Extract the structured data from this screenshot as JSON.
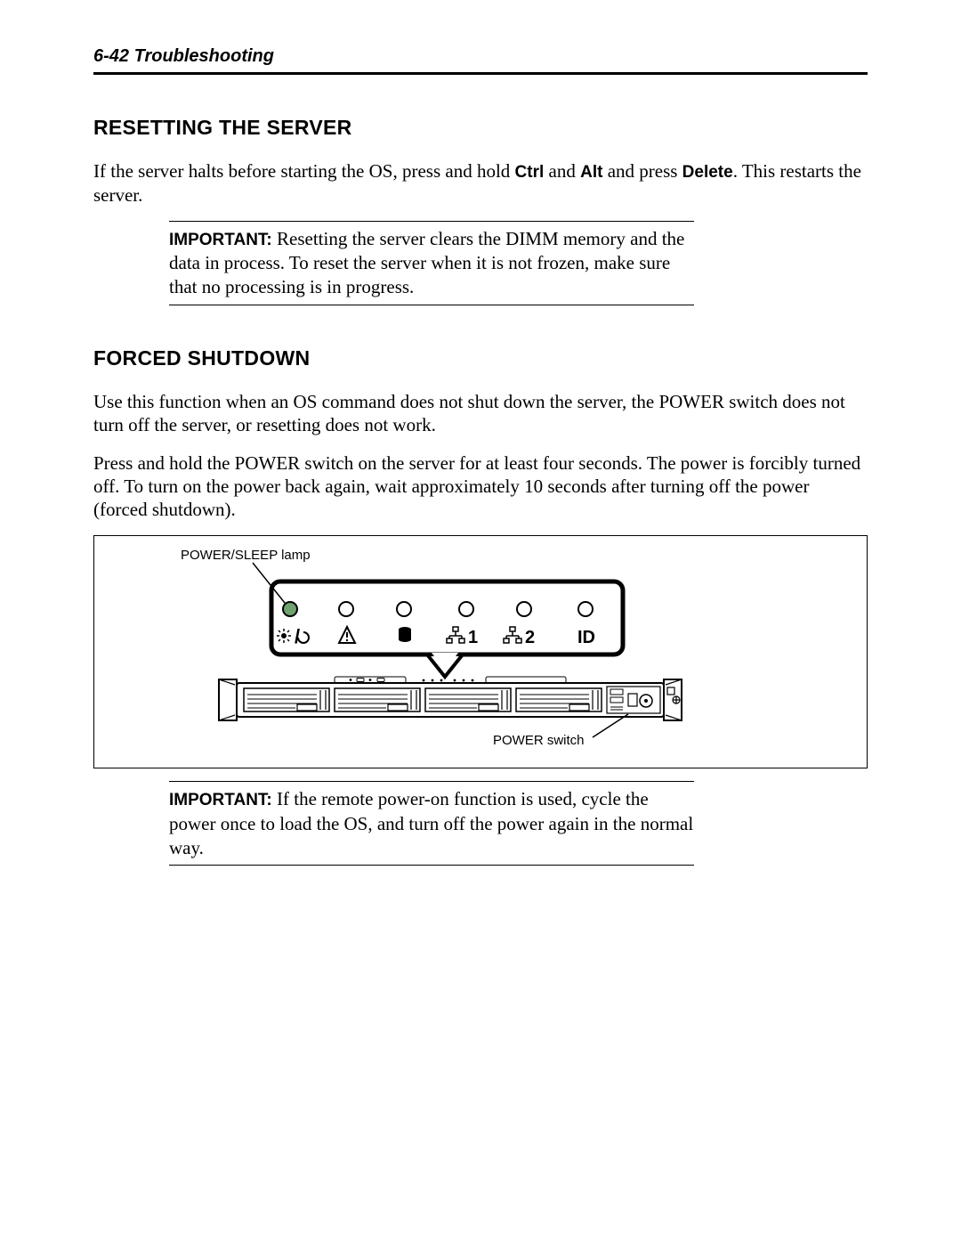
{
  "header": {
    "running": "6-42  Troubleshooting"
  },
  "section1": {
    "title": "RESETTING THE SERVER",
    "p1a": "If the server halts before starting the OS, press and hold ",
    "ctrl": "Ctrl",
    "p1b": " and ",
    "alt": "Alt",
    "p1c": " and press ",
    "del": "Delete",
    "p1d": ".  This restarts the server.",
    "note_label": "IMPORTANT:",
    "note_text": " Resetting the server clears the DIMM memory and the data in process.  To reset the server when it is not frozen, make sure that no processing is in progress."
  },
  "section2": {
    "title": "FORCED SHUTDOWN",
    "p1": "Use this function when an OS command does not shut down the server, the POWER switch does not turn off the server, or resetting does not work.",
    "p2": "Press and hold the POWER switch on the server for at least four seconds.  The power is forcibly turned off.  To turn on the power back again, wait approximately 10 seconds after turning off the power (forced shutdown).",
    "fig": {
      "lamp_label": "POWER/SLEEP lamp",
      "switch_label": "POWER switch",
      "panel_labels": {
        "net1": "1",
        "net2": "2",
        "id": "ID"
      }
    },
    "note_label": "IMPORTANT:",
    "note_text": " If the remote power-on function is used, cycle the power once to load the OS, and turn off the power again in the normal way."
  }
}
